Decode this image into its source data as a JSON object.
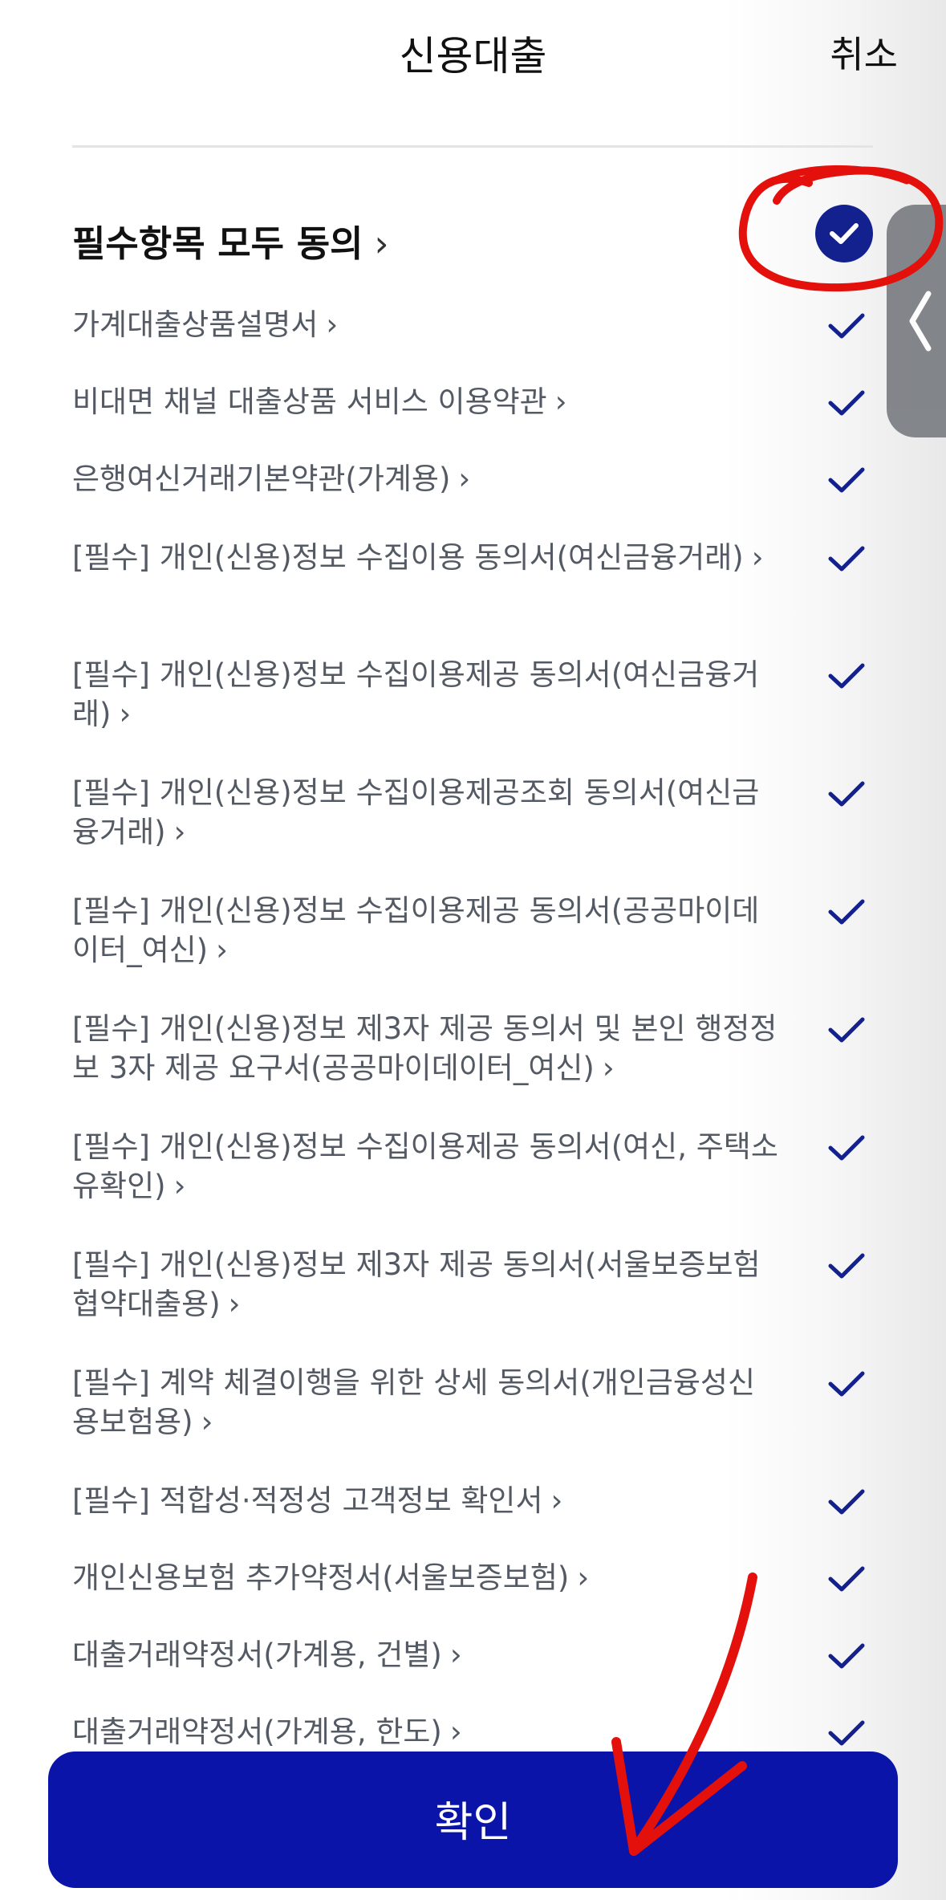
{
  "header": {
    "title": "신용대출",
    "cancel_label": "취소"
  },
  "agree_all": {
    "label": "필수항목 모두 동의",
    "chevron": "›",
    "checked": true,
    "icon": "check-circle-icon"
  },
  "items": [
    {
      "label": "가계대출상품설명서",
      "checked": true
    },
    {
      "label": "비대면 채널 대출상품 서비스 이용약관",
      "checked": true
    },
    {
      "label": "은행여신거래기본약관(가계용)",
      "checked": true
    },
    {
      "label": "[필수] 개인(신용)정보 수집이용 동의서(여신금융거래)",
      "checked": true
    },
    {
      "label": "[필수] 개인(신용)정보 수집이용제공 동의서(여신금융거래)",
      "checked": true
    },
    {
      "label": "[필수] 개인(신용)정보 수집이용제공조회 동의서(여신금융거래)",
      "checked": true
    },
    {
      "label": "[필수] 개인(신용)정보 수집이용제공 동의서(공공마이데이터_여신)",
      "checked": true
    },
    {
      "label": "[필수] 개인(신용)정보 제3자 제공 동의서 및 본인 행정정보 3자 제공 요구서(공공마이데이터_여신)",
      "checked": true
    },
    {
      "label": "[필수] 개인(신용)정보 수집이용제공 동의서(여신, 주택소유확인)",
      "checked": true
    },
    {
      "label": "[필수] 개인(신용)정보 제3자 제공 동의서(서울보증보험 협약대출용)",
      "checked": true
    },
    {
      "label": "[필수] 계약 체결이행을 위한 상세 동의서(개인금융성신용보험용)",
      "checked": true
    },
    {
      "label": "[필수] 적합성·적정성 고객정보 확인서",
      "checked": true
    },
    {
      "label": "개인신용보험 추가약정서(서울보증보험)",
      "checked": true
    },
    {
      "label": "대출거래약정서(가계용, 건별)",
      "checked": true
    },
    {
      "label": "대출거래약정서(가계용, 한도)",
      "checked": true
    }
  ],
  "chevron": "›",
  "confirm_label": "확인",
  "colors": {
    "accent": "#13218f",
    "button": "#0a14a8",
    "annotation": "#e3100c"
  }
}
